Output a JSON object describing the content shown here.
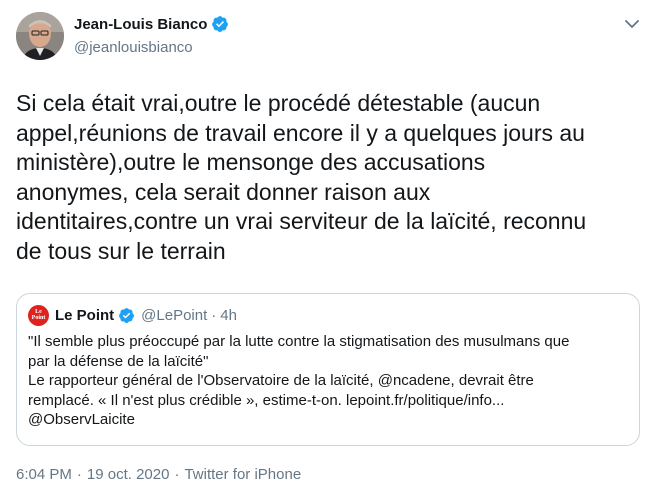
{
  "author": {
    "display_name": "Jean-Louis Bianco",
    "handle": "@jeanlouisbianco",
    "verified": true
  },
  "tweet": {
    "lines": [
      "Si cela était vrai,outre le procédé détestable (aucun",
      "appel,réunions de travail encore il y a quelques jours au",
      "ministère),outre le mensonge des accusations",
      "anonymes, cela serait donner raison aux",
      "identitaires,contre un vrai serviteur de la laïcité, reconnu",
      "de tous sur le terrain"
    ]
  },
  "quote": {
    "avatar_text": "Le Point",
    "display_name": "Le Point",
    "handle": "@LePoint",
    "dot": "·",
    "time": "4h",
    "lines": [
      "\"Il semble plus préoccupé par la lutte contre la stigmatisation des musulmans que",
      "par la défense de la laïcité\"",
      "Le rapporteur général de l'Observatoire de la laïcité, @ncadene, devrait être",
      "remplacé. « Il n'est plus crédible », estime-t-on. lepoint.fr/politique/info...",
      "@ObservLaicite"
    ]
  },
  "footer": {
    "time": "6:04 PM",
    "date": "19 oct. 2020",
    "source": "Twitter for iPhone",
    "separator": "·"
  },
  "colors": {
    "verified": "#1da1f2",
    "secondary_text": "#657786",
    "border": "#ccd6dd",
    "brand_red": "#e0221e"
  },
  "icons": {
    "verified": "verified-badge-icon",
    "caret": "chevron-down-icon"
  }
}
